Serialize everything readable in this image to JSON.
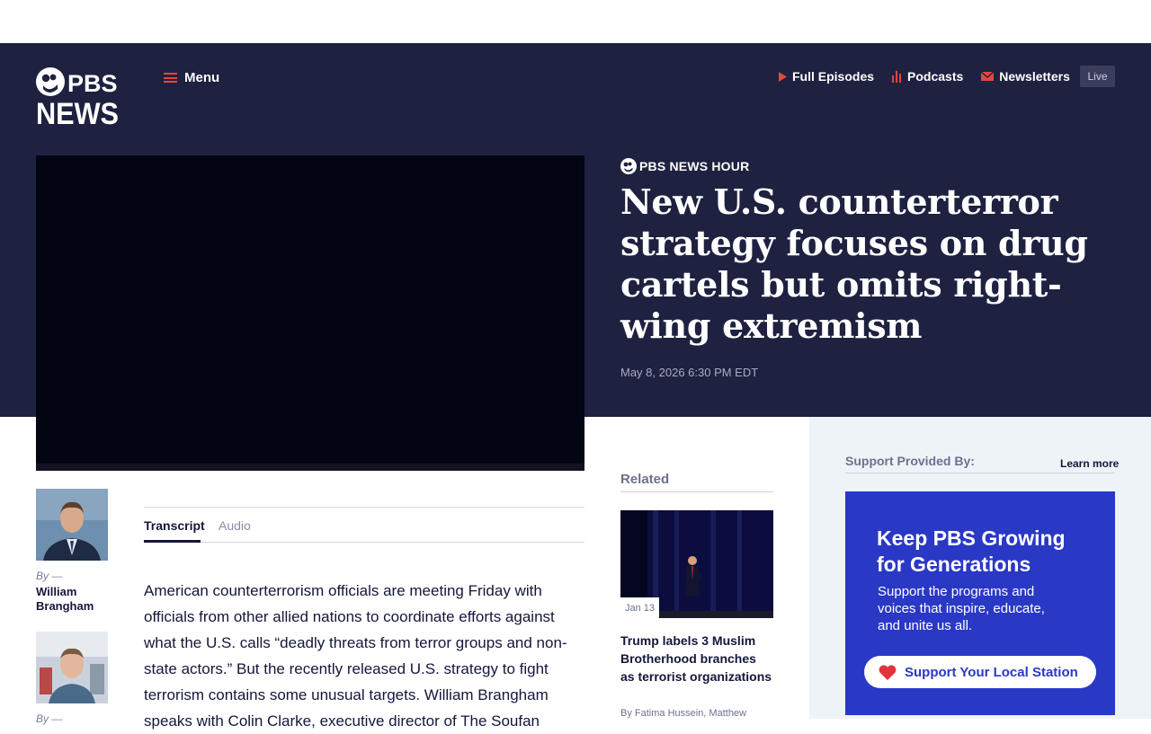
{
  "header": {
    "logo_line1": "PBS",
    "logo_line2": "NEWS",
    "menu_label": "Menu",
    "nav": [
      {
        "label": "Full Episodes",
        "icon": "play-icon"
      },
      {
        "label": "Podcasts",
        "icon": "podcast-icon"
      },
      {
        "label": "Newsletters",
        "icon": "mail-icon"
      }
    ],
    "live_label": "Live"
  },
  "article": {
    "show_label": "PBS NEWS HOUR",
    "headline": "New U.S. counterterror strategy focuses on drug cartels but omits right-wing extremism",
    "date": "May 8, 2026 6:30 PM EDT",
    "authors": [
      {
        "by": "By —",
        "name": "William Brangham"
      },
      {
        "by": "By —",
        "name": ""
      }
    ],
    "tabs": [
      "Transcript",
      "Audio"
    ],
    "body": "American counterterrorism officials are meeting Friday with officials from other allied nations to coordinate efforts against what the U.S. calls “deadly threats from terror groups and non-state actors.” But the recently released U.S. strategy to fight terrorism contains some unusual targets. William Brangham speaks with Colin Clarke, executive director of The Soufan"
  },
  "related": {
    "label": "Related",
    "items": [
      {
        "date": "Jan 13",
        "title": "Trump labels 3 Muslim Brotherhood branches as terrorist organizations",
        "byline": "By Fatima Hussein, Matthew"
      }
    ]
  },
  "sidebar": {
    "support_label": "Support Provided By:",
    "learn_more": "Learn more",
    "ad": {
      "title": "Keep PBS Growing for Generations",
      "text": "Support the programs and voices that inspire, educate, and unite us all.",
      "button": "Support Your Local Station"
    }
  },
  "colors": {
    "header_bg": "#1e2140",
    "accent_red": "#e5463f",
    "ad_blue": "#2a38c6",
    "sidebar_bg": "#eef3f8"
  }
}
